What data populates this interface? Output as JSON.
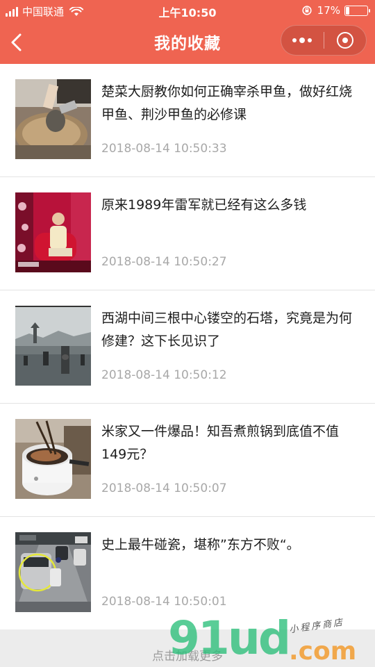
{
  "status_bar": {
    "carrier": "中国联通",
    "time": "上午10:50",
    "battery_percent": "17%",
    "battery_level": 0.17,
    "signal_bars": 4
  },
  "nav": {
    "title": "我的收藏",
    "back_icon": "chevron-left-icon",
    "more_icon": "more-dots-icon",
    "close_icon": "target-circle-icon",
    "bar_color": "#ef6451"
  },
  "favorites": [
    {
      "title": "楚菜大厨教你如何正确宰杀甲鱼，做好红烧甲鱼、荆沙甲鱼的必修课",
      "time": "2018-08-14 10:50:33",
      "thumb": "cooking-turtle"
    },
    {
      "title": "原来1989年雷军就已经有这么多钱",
      "time": "2018-08-14 10:50:27",
      "thumb": "tv-interview"
    },
    {
      "title": "西湖中间三根中心镂空的石塔，究竟是为何修建？这下长见识了",
      "time": "2018-08-14 10:50:12",
      "thumb": "west-lake-pagodas"
    },
    {
      "title": "米家又一件爆品！知吾煮煎锅到底值不值149元？",
      "time": "2018-08-14 10:50:07",
      "thumb": "cooking-pot"
    },
    {
      "title": "史上最牛碰瓷，堪称”东方不败“。",
      "time": "2018-08-14 10:50:01",
      "thumb": "traffic-camera"
    }
  ],
  "footer": {
    "load_more": "点击加载更多"
  },
  "watermark": {
    "main": "91ud",
    "domain": ".com",
    "sub": "小程序商店"
  }
}
